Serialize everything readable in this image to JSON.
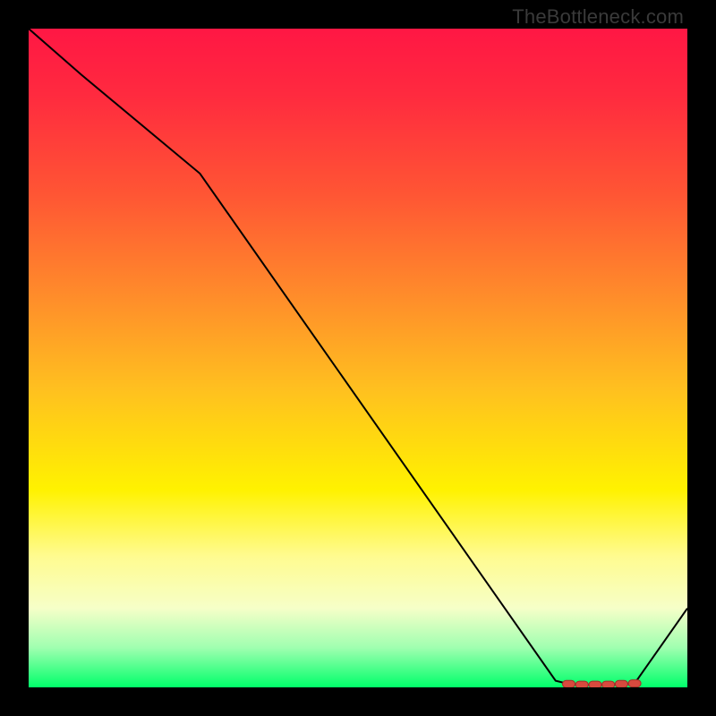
{
  "watermark": "TheBottleneck.com",
  "colors": {
    "line": "#000000",
    "marker_fill": "#d84a3e",
    "marker_stroke": "#a23028"
  },
  "chart_data": {
    "type": "line",
    "title": "",
    "xlabel": "",
    "ylabel": "",
    "xlim": [
      0,
      100
    ],
    "ylim": [
      0,
      100
    ],
    "grid": false,
    "legend": false,
    "x": [
      0,
      8,
      26,
      80,
      82,
      84,
      86,
      88,
      90,
      92,
      100
    ],
    "values": [
      100,
      93,
      78,
      1,
      0.5,
      0.4,
      0.4,
      0.4,
      0.5,
      0.6,
      12
    ],
    "markers": {
      "x": [
        82,
        84,
        86,
        88,
        90,
        92
      ],
      "values": [
        0.5,
        0.4,
        0.4,
        0.4,
        0.5,
        0.6
      ]
    }
  }
}
